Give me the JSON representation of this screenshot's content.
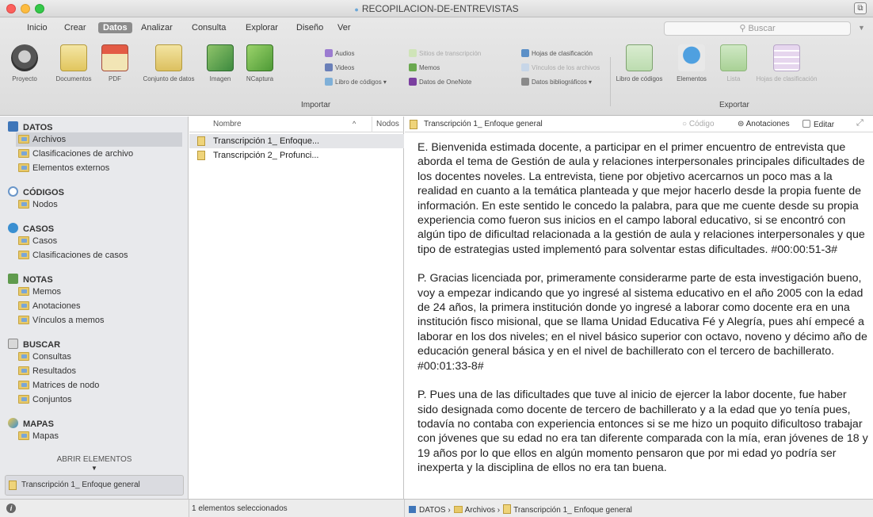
{
  "window": {
    "title": "RECOPILACION-DE-ENTREVISTAS"
  },
  "tabs": [
    "Inicio",
    "Crear",
    "Datos",
    "Analizar",
    "Consulta",
    "Explorar",
    "Diseño",
    "Ver"
  ],
  "search": {
    "placeholder": "Buscar"
  },
  "ribbon": {
    "import_buttons": [
      "Proyecto",
      "Documentos",
      "PDF",
      "Conjunto de datos",
      "Imagen",
      "NCaptura"
    ],
    "import_small_col1": [
      "Audios",
      "Videos",
      "Libro de códigos ▾"
    ],
    "import_small_col2": [
      "Sitios de transcripción",
      "Memos",
      "Datos de OneNote"
    ],
    "import_small_col3": [
      "Hojas de clasificación",
      "Vínculos de los archivos",
      "Datos bibliográficos ▾"
    ],
    "import_label": "Importar",
    "export_buttons": [
      "Libro de códigos",
      "Elementos",
      "Lista",
      "Hojas de clasificación"
    ],
    "export_label": "Exportar"
  },
  "nav": {
    "datos": {
      "title": "DATOS",
      "items": [
        "Archivos",
        "Clasificaciones de archivo",
        "Elementos externos"
      ]
    },
    "codigos": {
      "title": "CÓDIGOS",
      "items": [
        "Nodos"
      ]
    },
    "casos": {
      "title": "CASOS",
      "items": [
        "Casos",
        "Clasificaciones de casos"
      ]
    },
    "notas": {
      "title": "NOTAS",
      "items": [
        "Memos",
        "Anotaciones",
        "Vínculos a memos"
      ]
    },
    "buscar": {
      "title": "BUSCAR",
      "items": [
        "Consultas",
        "Resultados",
        "Matrices de nodo",
        "Conjuntos"
      ]
    },
    "mapas": {
      "title": "MAPAS",
      "items": [
        "Mapas"
      ]
    },
    "open_items_label": "ABRIR ELEMENTOS",
    "open_doc": "Transcripción 1_ Enfoque general"
  },
  "list": {
    "col_name": "Nombre",
    "sort_icon": "^",
    "col_nodes": "Nodos",
    "rows": [
      "Transcripción 1_ Enfoque...",
      "Transcripción 2_ Profunci..."
    ]
  },
  "doc": {
    "title": "Transcripción 1_ Enfoque general",
    "codigo": "Código",
    "anotaciones": "Anotaciones",
    "editar": "Editar",
    "paragraphs": [
      "E. Bienvenida estimada docente, a participar en el primer encuentro de entrevista que aborda el tema de Gestión de aula y relaciones interpersonales principales dificultades de los docentes noveles. La entrevista, tiene por objetivo acercarnos un poco mas a la realidad en cuanto a la temática planteada y que mejor hacerlo desde la propia fuente de información. En este sentido le concedo la palabra, para que me cuente desde su propia experiencia como fueron sus inicios en el campo laboral educativo, si se encontró con algún tipo de dificultad relacionada a la gestión de aula y relaciones interpersonales y que tipo de estrategias usted implementó para solventar estas dificultades. #00:00:51-3#",
      "P. Gracias licenciada por, primeramente considerarme parte de esta investigación bueno, voy a empezar indicando que yo ingresé al sistema educativo en el año 2005 con la edad de 24 años, la primera institución donde yo ingresé a laborar como docente era en una institución fisco misional, que se llama Unidad Educativa Fé y Alegría, pues ahí empecé a laborar en los dos niveles; en el nivel básico superior con octavo, noveno y décimo año de educación general básica y en el nivel de bachillerato con el tercero de bachillerato. #00:01:33-8#",
      "P. Pues una de las dificultades que tuve al inicio de ejercer la labor docente, fue haber sido designada como docente de tercero de bachillerato y a la edad que yo tenía pues, todavía no contaba con experiencia entonces si se me hizo un poquito dificultoso trabajar con jóvenes que su edad no era tan diferente comparada con la mía, eran jóvenes de 18 y 19 años por lo que ellos en algún momento pensaron que por mi edad yo podría ser inexperta y la disciplina de ellos no era tan buena."
    ]
  },
  "status": {
    "selected": "1 elementos seleccionados",
    "breadcrumb": [
      "DATOS",
      "Archivos",
      "Transcripción 1_ Enfoque general"
    ],
    "bc_sep": "›"
  }
}
